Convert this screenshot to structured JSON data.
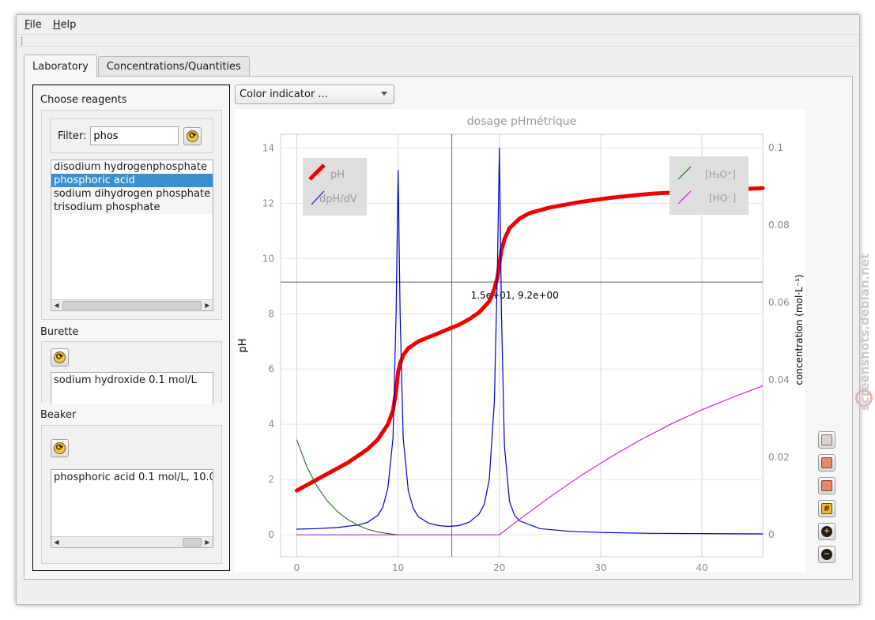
{
  "menu": {
    "file": "File",
    "help": "Help"
  },
  "tabs": [
    {
      "label": "Laboratory"
    },
    {
      "label": "Concentrations/Quantities"
    }
  ],
  "reagents": {
    "title": "Choose reagents",
    "filter_label": "Filter:",
    "filter_value": "phos",
    "items": [
      "disodium hydrogenphosphate",
      "phosphoric acid",
      "sodium dihydrogen phosphate",
      "trisodium phosphate"
    ],
    "selected_index": 1
  },
  "burette": {
    "title": "Burette",
    "content": "sodium hydroxide 0.1 mol/L"
  },
  "beaker": {
    "title": "Beaker",
    "content": "phosphoric acid 0.1 mol/L, 10.0"
  },
  "color_indicator": {
    "label": "Color indicator ..."
  },
  "watermark": "screenshots.debian.net",
  "colors": {
    "pH": "#ee0000",
    "dpHdV": "#0000cc",
    "H3O": "#006600",
    "HO": "#cc00cc",
    "selection": "#3a8fd0"
  },
  "side_tools": [
    "export-icon",
    "save-image-icon",
    "print-icon",
    "grid-icon",
    "zoom-in-icon",
    "zoom-out-icon"
  ],
  "chart_data": {
    "type": "line",
    "title": "dosage pHmétrique",
    "ylabel": "pH",
    "y2label": "concentration (mol·L⁻¹)",
    "xlabel": "",
    "xlim": [
      -1.6,
      46
    ],
    "ylim": [
      -0.8,
      14.5
    ],
    "y2lim": [
      -0.0057,
      0.1035
    ],
    "x_ticks": [
      "0",
      "10",
      "20",
      "30",
      "40"
    ],
    "x_tick_values": [
      0,
      10,
      20,
      30,
      40
    ],
    "y_ticks": [
      "0",
      "2",
      "4",
      "6",
      "8",
      "10",
      "12",
      "14"
    ],
    "y_tick_values": [
      0,
      2,
      4,
      6,
      8,
      10,
      12,
      14
    ],
    "y2_ticks": [
      "0",
      "0.02",
      "0.04",
      "0.06",
      "0.08",
      "0.1"
    ],
    "y2_tick_values": [
      0,
      0.02,
      0.04,
      0.06,
      0.08,
      0.1
    ],
    "cursor": {
      "x": 15.3,
      "y": 9.15,
      "label": "1.5e+01, 9.2e+00"
    },
    "legend_left": [
      {
        "name": "pH"
      },
      {
        "name": "dpH/dV"
      }
    ],
    "legend_right": [
      {
        "name": "[H₃O⁺]"
      },
      {
        "name": "[HO⁻]"
      }
    ],
    "series": [
      {
        "name": "pH",
        "axis": "left",
        "x": [
          0,
          1,
          2,
          3,
          4,
          5,
          6,
          7,
          8,
          9,
          9.5,
          9.8,
          10,
          10.2,
          10.5,
          11,
          12,
          13,
          14,
          15,
          16,
          17,
          18,
          19,
          19.5,
          19.8,
          20,
          20.2,
          20.5,
          21,
          22,
          23,
          25,
          28,
          31,
          35,
          40,
          46
        ],
        "y": [
          1.6,
          1.8,
          2.0,
          2.2,
          2.4,
          2.6,
          2.85,
          3.1,
          3.45,
          4.0,
          4.5,
          5.2,
          5.9,
          6.2,
          6.5,
          6.75,
          7.0,
          7.15,
          7.3,
          7.45,
          7.6,
          7.8,
          8.05,
          8.45,
          8.9,
          9.3,
          9.8,
          10.3,
          10.7,
          11.1,
          11.45,
          11.65,
          11.85,
          12.05,
          12.2,
          12.35,
          12.45,
          12.55
        ]
      },
      {
        "name": "dpH/dV",
        "axis": "left",
        "x": [
          0,
          2,
          4,
          6,
          7,
          8,
          8.5,
          9,
          9.5,
          9.8,
          10,
          10.2,
          10.5,
          11,
          11.5,
          12,
          13,
          14,
          15,
          16,
          17,
          18,
          18.5,
          19,
          19.5,
          19.8,
          20,
          20.2,
          20.5,
          21,
          21.5,
          22,
          24,
          27,
          30,
          35,
          40,
          46
        ],
        "y": [
          0.2,
          0.22,
          0.26,
          0.35,
          0.45,
          0.7,
          1.0,
          1.7,
          3.5,
          8.0,
          13.2,
          8.0,
          3.5,
          1.6,
          0.95,
          0.65,
          0.42,
          0.33,
          0.3,
          0.33,
          0.45,
          0.75,
          1.1,
          2.0,
          4.8,
          9.5,
          14.0,
          8.0,
          3.2,
          1.2,
          0.7,
          0.5,
          0.22,
          0.12,
          0.08,
          0.05,
          0.04,
          0.03
        ]
      },
      {
        "name": "[H₃O⁺]",
        "axis": "right",
        "x": [
          0,
          1,
          2,
          3,
          4,
          5,
          6,
          7,
          8,
          9,
          10
        ],
        "y": [
          0.0245,
          0.0175,
          0.0125,
          0.0088,
          0.006,
          0.004,
          0.0025,
          0.0014,
          0.0007,
          0.0003,
          0.0
        ]
      },
      {
        "name": "[HO⁻]",
        "axis": "right",
        "x": [
          0,
          20,
          22,
          25,
          28,
          31,
          34,
          37,
          40,
          43,
          46
        ],
        "y": [
          0,
          0,
          0.004,
          0.0098,
          0.0152,
          0.0201,
          0.0246,
          0.0287,
          0.0323,
          0.0355,
          0.0385
        ]
      }
    ]
  }
}
